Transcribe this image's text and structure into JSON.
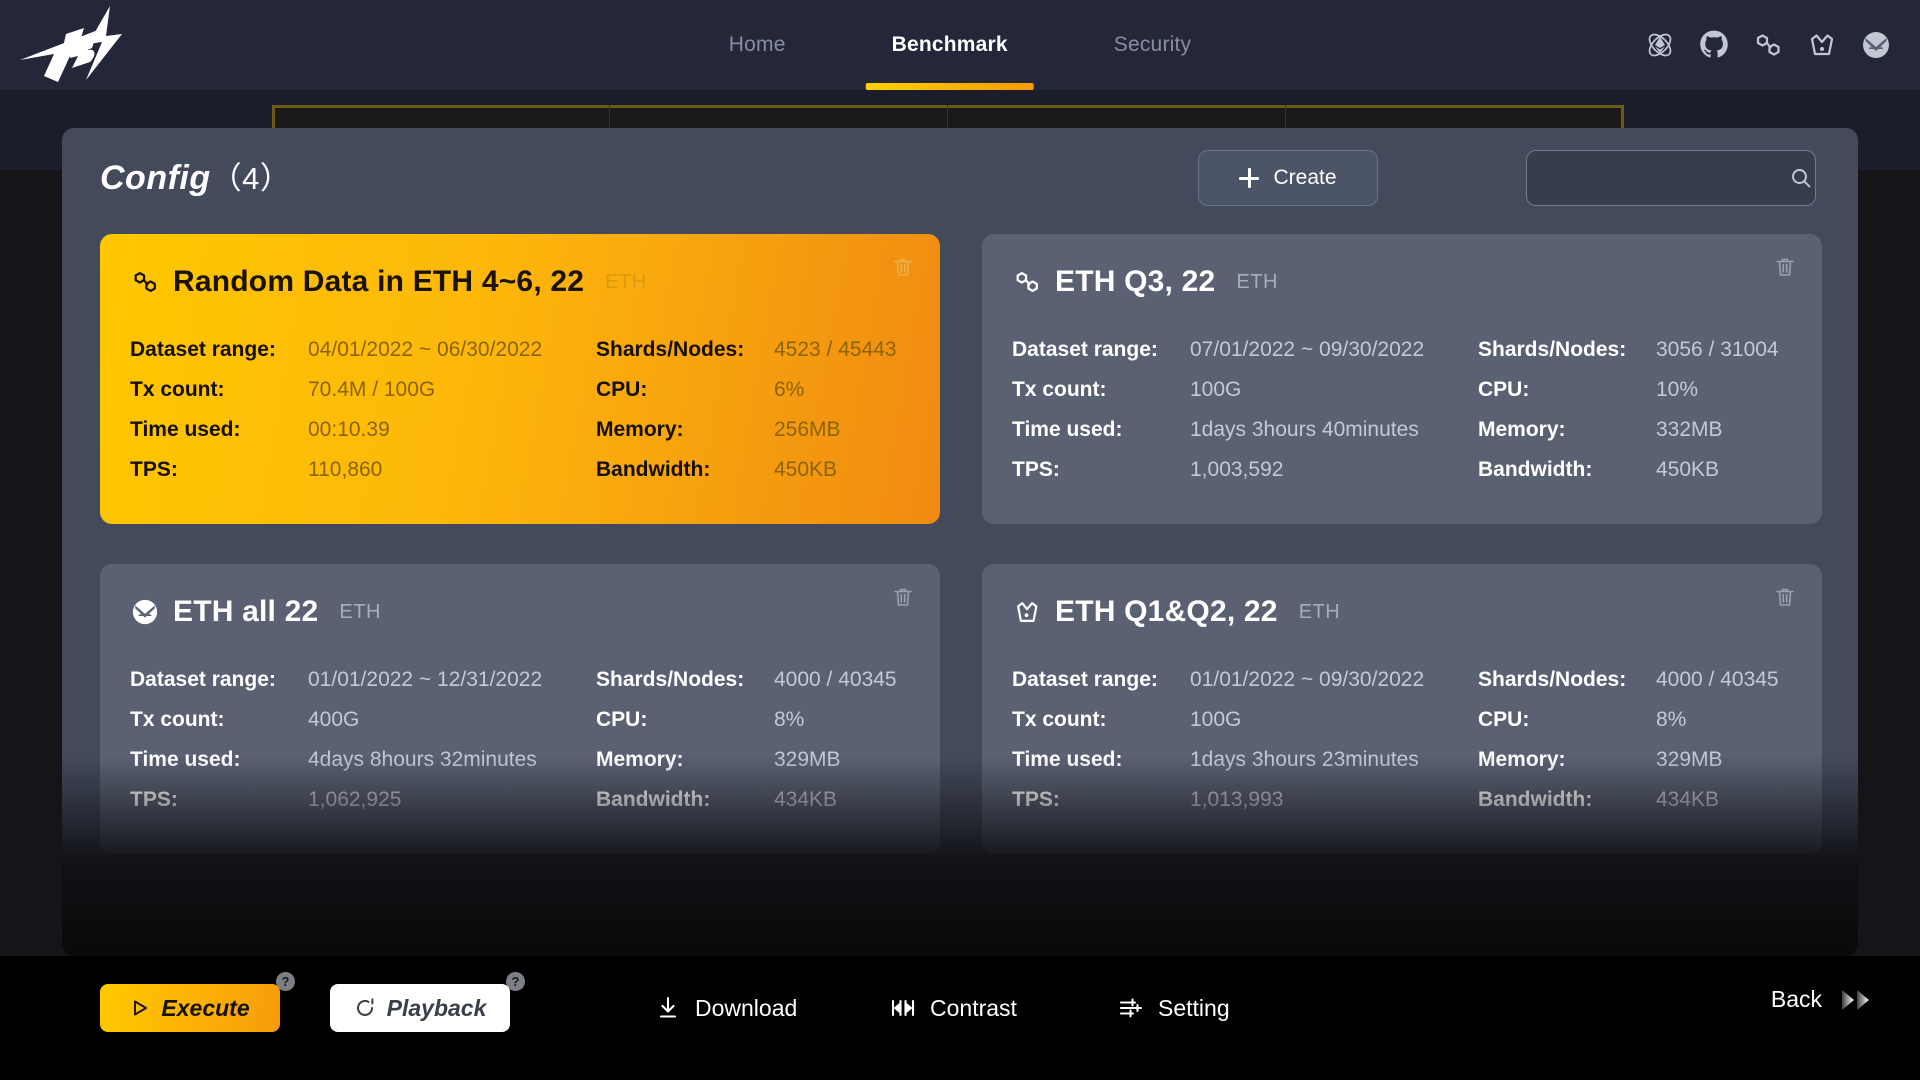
{
  "header": {
    "logo_alt": "TB",
    "nav": [
      {
        "label": "Home",
        "active": false
      },
      {
        "label": "Benchmark",
        "active": true
      },
      {
        "label": "Security",
        "active": false
      }
    ],
    "icons": [
      "ethereum-icon",
      "github-icon",
      "chainlink-icon",
      "crown-icon",
      "mask-icon"
    ]
  },
  "panel": {
    "title": "Config",
    "count": "（4）",
    "create_label": "Create",
    "search_placeholder": "",
    "search_value": ""
  },
  "colors": {
    "accent_start": "#ffc900",
    "accent_end": "#f08a12",
    "panel_bg": "#434a5c",
    "card_bg": "#5a6173",
    "header_bg": "#24263a"
  },
  "field_labels": {
    "dataset_range": "Dataset range:",
    "shards_nodes": "Shards/Nodes:",
    "tx_count": "Tx count:",
    "cpu": "CPU:",
    "time_used": "Time used:",
    "memory": "Memory:",
    "tps": "TPS:",
    "bandwidth": "Bandwidth:"
  },
  "cards": [
    {
      "icon": "chainlink-icon",
      "title": "Random Data in ETH 4~6, 22",
      "tag": "ETH",
      "active": true,
      "dataset_range": "04/01/2022 ~ 06/30/2022",
      "shards_nodes": "4523 / 45443",
      "tx_count": "70.4M / 100G",
      "cpu": "6%",
      "time_used": "00:10.39",
      "memory": "256MB",
      "tps": "110,860",
      "bandwidth": "450KB"
    },
    {
      "icon": "chainlink-icon",
      "title": "ETH Q3, 22",
      "tag": "ETH",
      "active": false,
      "dataset_range": "07/01/2022 ~ 09/30/2022",
      "shards_nodes": "3056 / 31004",
      "tx_count": "100G",
      "cpu": "10%",
      "time_used": "1days 3hours 40minutes",
      "memory": "332MB",
      "tps": "1,003,592",
      "bandwidth": "450KB"
    },
    {
      "icon": "mask-icon",
      "title": "ETH all 22",
      "tag": "ETH",
      "active": false,
      "dataset_range": "01/01/2022 ~ 12/31/2022",
      "shards_nodes": "4000 / 40345",
      "tx_count": "400G",
      "cpu": "8%",
      "time_used": "4days 8hours 32minutes",
      "memory": "329MB",
      "tps": "1,062,925",
      "bandwidth": "434KB"
    },
    {
      "icon": "crown-icon",
      "title": "ETH Q1&Q2, 22",
      "tag": "ETH",
      "active": false,
      "dataset_range": "01/01/2022 ~ 09/30/2022",
      "shards_nodes": "4000 / 40345",
      "tx_count": "100G",
      "cpu": "8%",
      "time_used": "1days 3hours 23minutes",
      "memory": "329MB",
      "tps": "1,013,993",
      "bandwidth": "434KB"
    }
  ],
  "bottom": {
    "execute_label": "Execute",
    "playback_label": "Playback",
    "help_badge": "?",
    "tools": [
      {
        "label": "Download",
        "icon": "download-icon"
      },
      {
        "label": "Contrast",
        "icon": "contrast-icon"
      },
      {
        "label": "Setting",
        "icon": "sliders-icon"
      }
    ],
    "back_label": "Back"
  }
}
